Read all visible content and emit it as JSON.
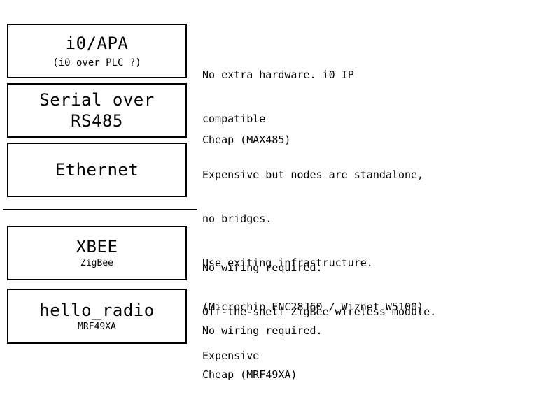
{
  "rows": [
    {
      "title_lines": [
        "i0/APA"
      ],
      "subtitle": "(i0 over PLC ?)",
      "description": [
        "No extra hardware. i0 IP",
        "compatible"
      ]
    },
    {
      "title_lines": [
        "Serial over",
        "RS485"
      ],
      "subtitle": "",
      "description": [
        "Cheap (MAX485)"
      ]
    },
    {
      "title_lines": [
        "Ethernet"
      ],
      "subtitle": "",
      "description": [
        "Expensive but nodes are standalone,",
        "no bridges.",
        "Use exiting infrastructure.",
        "(Microchip ENC28J60 / Wiznet W5100)"
      ]
    },
    {
      "title_lines": [
        "XBEE"
      ],
      "subtitle": "ZigBee",
      "description": [
        "No wiring required.",
        "Off-the-shelf ZigBee wireless module.",
        "Expensive"
      ]
    },
    {
      "title_lines": [
        "hello_radio"
      ],
      "subtitle": "MRF49XA",
      "description": [
        "No wiring required.",
        "Cheap (MRF49XA)"
      ]
    }
  ]
}
